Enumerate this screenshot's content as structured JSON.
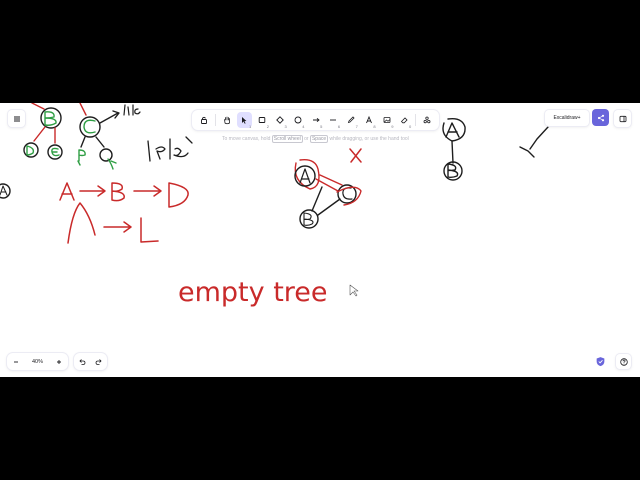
{
  "toolbar": {
    "tools": [
      {
        "name": "lock",
        "key": ""
      },
      {
        "name": "hand",
        "key": ""
      },
      {
        "name": "selection",
        "key": "1"
      },
      {
        "name": "rectangle",
        "key": "2"
      },
      {
        "name": "diamond",
        "key": "3"
      },
      {
        "name": "ellipse",
        "key": "4"
      },
      {
        "name": "arrow",
        "key": "5"
      },
      {
        "name": "line",
        "key": "6"
      },
      {
        "name": "draw",
        "key": "7"
      },
      {
        "name": "text",
        "key": "8"
      },
      {
        "name": "image",
        "key": "9"
      },
      {
        "name": "eraser",
        "key": "0"
      },
      {
        "name": "extra-tools",
        "key": ""
      }
    ],
    "active_tool": "selection"
  },
  "hint": {
    "prefix": "To move canvas, hold",
    "key1": "Scroll wheel",
    "middle": "or",
    "key2": "Space",
    "suffix": "while dragging, or use the hand tool"
  },
  "header_right": {
    "library_label": "Excalidraw+"
  },
  "footer": {
    "zoom_level": "40%"
  },
  "canvas": {
    "text_empty_tree": "empty tree",
    "colors": {
      "red": "#c92a2a",
      "green": "#2f9e44",
      "black": "#1e1e1e"
    }
  },
  "colors": {
    "accent": "#6965db",
    "active_tool_bg": "#e0dfff",
    "canvas_bg": "#ffffff"
  }
}
